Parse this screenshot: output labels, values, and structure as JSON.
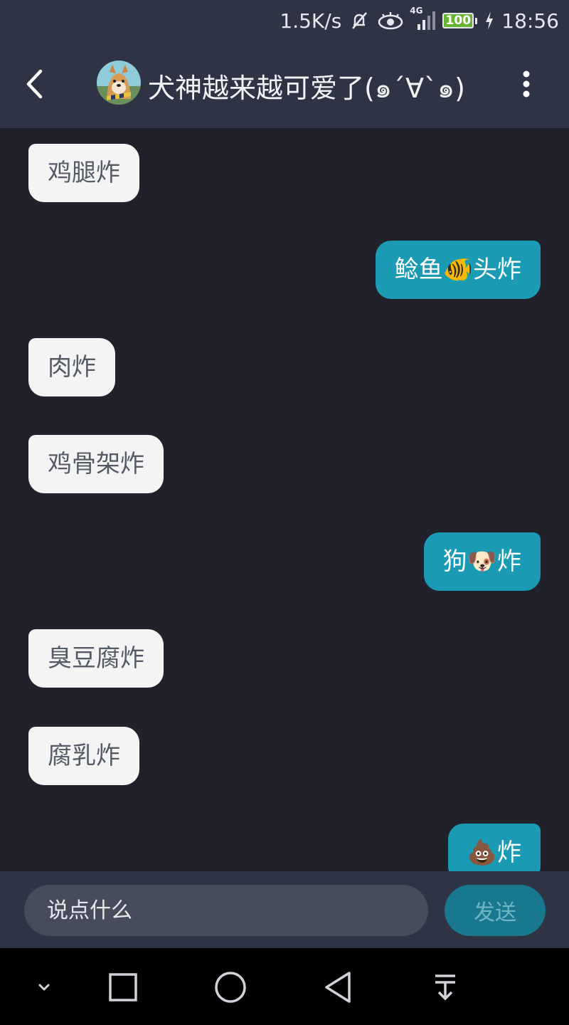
{
  "status_bar": {
    "speed": "1.5K/s",
    "network": "4G",
    "battery": "100",
    "time": "18:56",
    "icons": [
      "mute-icon",
      "eye-icon",
      "signal-icon",
      "battery-icon",
      "charging-icon"
    ]
  },
  "header": {
    "title": "犬神越来越可爱了(๑´∀`๑)",
    "back_icon": "chevron-left-icon",
    "more_icon": "more-vertical-icon"
  },
  "messages": [
    {
      "side": "in",
      "text": "鸡腿炸"
    },
    {
      "side": "out",
      "text": "鲶鱼🐠头炸"
    },
    {
      "side": "in",
      "text": "肉炸"
    },
    {
      "side": "in",
      "text": "鸡骨架炸"
    },
    {
      "side": "out",
      "text": "狗🐶炸"
    },
    {
      "side": "in",
      "text": "臭豆腐炸"
    },
    {
      "side": "in",
      "text": "腐乳炸"
    },
    {
      "side": "out",
      "text": "💩炸"
    }
  ],
  "input": {
    "placeholder": "说点什么",
    "send_label": "发送"
  },
  "nav": {
    "icons": [
      "collapse-icon",
      "recents-icon",
      "home-icon",
      "back-icon",
      "notifications-icon"
    ]
  },
  "colors": {
    "background": "#20212b",
    "bar": "#2e3443",
    "incoming_bubble": "#f4f4f4",
    "outgoing_bubble": "#1a9ab3",
    "send_button": "#18788d"
  }
}
